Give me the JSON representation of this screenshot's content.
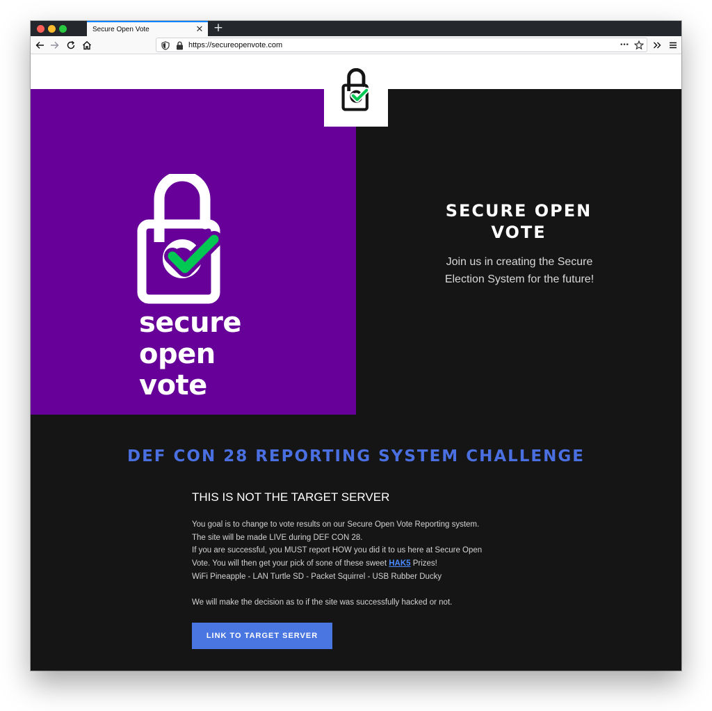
{
  "browser": {
    "tab_title": "Secure Open Vote",
    "tab_close": "✕",
    "new_tab": "+",
    "url": "https://secureopenvote.com",
    "more_actions": "•••"
  },
  "logo": {
    "wordmark_line1": "secure",
    "wordmark_line2": "open",
    "wordmark_line3": "vote",
    "check_color": "#00c853",
    "lock_color": "#ffffff",
    "brand_purple": "#660099"
  },
  "hero": {
    "title": "SECURE OPEN VOTE",
    "subtitle": "Join us in creating the Secure Election System for the future!"
  },
  "challenge": {
    "title": "DEF CON 28 REPORTING SYSTEM CHALLENGE",
    "notice": "THIS IS NOT THE TARGET SERVER",
    "line1": "You goal is to change to vote results on our Secure Open Vote Reporting system.",
    "line2": "The site will be made LIVE during DEF CON 28.",
    "line3": "If you are successful, you MUST report HOW you did it to us here at Secure Open",
    "line4_before": "Vote. You will then get your pick of sone of these sweet ",
    "line4_link": "HAK5",
    "line4_after": " Prizes!",
    "line5": "WiFi Pineapple - LAN Turtle SD - Packet Squirrel - USB Rubber Ducky",
    "line6": "We will make the decision as to if the site was successfully hacked or not.",
    "button_label": "LINK TO TARGET SERVER",
    "accent_color": "#4a6fe0"
  }
}
